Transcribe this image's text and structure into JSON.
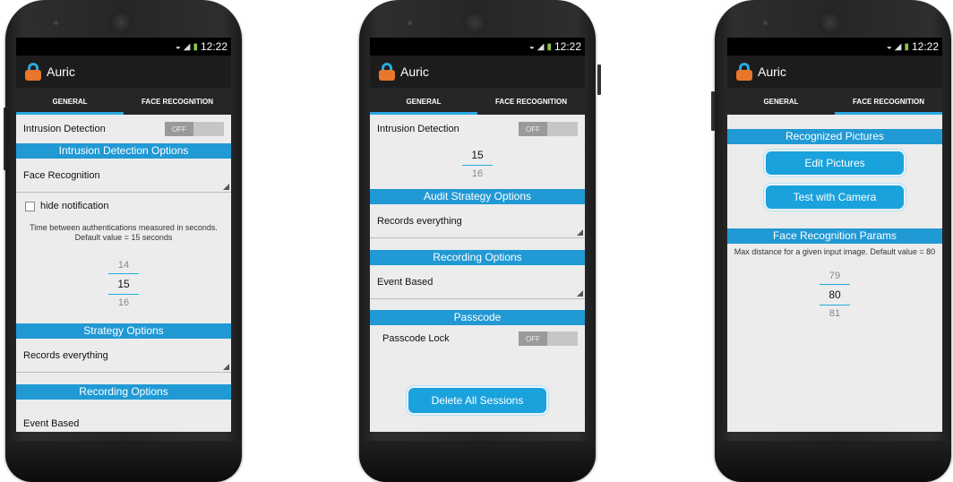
{
  "app": {
    "status_time": "12:22",
    "title": "Auric",
    "tabs": {
      "general": "GENERAL",
      "face": "FACE RECOGNITION"
    }
  },
  "screen1": {
    "intrusion_label": "Intrusion Detection",
    "intrusion_toggle": "OFF",
    "options_header": "Intrusion Detection Options",
    "method_value": "Face Recognition",
    "hide_notification": "hide notification",
    "hint": "Time between authentications measured in seconds. Default value = 15 seconds",
    "picker": {
      "prev": "14",
      "current": "15",
      "next": "16"
    },
    "strategy_header": "Strategy Options",
    "strategy_value": "Records everything",
    "recording_header": "Recording Options",
    "recording_value": "Event Based"
  },
  "screen2": {
    "intrusion_label": "Intrusion Detection",
    "intrusion_toggle": "OFF",
    "picker": {
      "current": "15",
      "next": "16"
    },
    "audit_header": "Audit Strategy Options",
    "audit_value": "Records everything",
    "recording_header": "Recording Options",
    "recording_value": "Event Based",
    "passcode_header": "Passcode",
    "passcode_label": "Passcode Lock",
    "passcode_toggle": "OFF",
    "delete_button": "Delete All Sessions"
  },
  "screen3": {
    "pictures_header": "Recognized Pictures",
    "edit_button": "Edit Pictures",
    "test_button": "Test with Camera",
    "params_header": "Face Recognition Params",
    "hint": "Max distance for a given input image. Default value = 80",
    "picker": {
      "prev": "79",
      "current": "80",
      "next": "81"
    }
  },
  "colors": {
    "accent": "#29a9e0",
    "header": "#2199d4",
    "logo_orange": "#e8762c"
  }
}
